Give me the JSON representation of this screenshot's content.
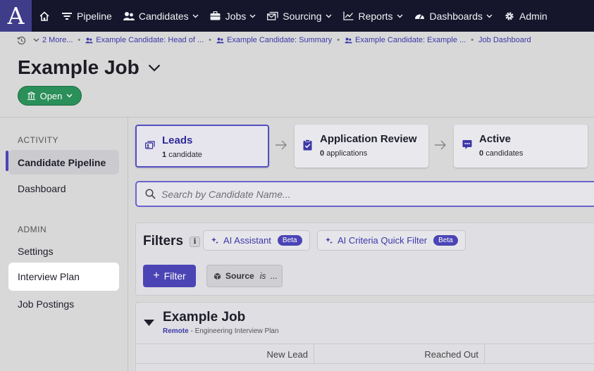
{
  "app": {
    "logo_letter": "A",
    "brand_colors": {
      "nav_bg": "#15152b",
      "accent": "#4b44b5",
      "logo_bg": "#3f3d8a",
      "status_green": "#2a8f59"
    }
  },
  "nav": {
    "items": [
      {
        "label": "Pipeline",
        "icon": "funnel-icon"
      },
      {
        "label": "Candidates",
        "icon": "people-icon"
      },
      {
        "label": "Jobs",
        "icon": "briefcase-icon"
      },
      {
        "label": "Sourcing",
        "icon": "mail-stack-icon"
      },
      {
        "label": "Reports",
        "icon": "chart-icon"
      },
      {
        "label": "Dashboards",
        "icon": "gauge-icon"
      },
      {
        "label": "Admin",
        "icon": "gear-icon"
      }
    ]
  },
  "breadcrumbs": {
    "more_label": "2 More...",
    "items": [
      "Example Candidate: Head of ...",
      "Example Candidate: Summary",
      "Example Candidate: Example ...",
      "Job Dashboard"
    ]
  },
  "header": {
    "title": "Example Job",
    "status": "Open"
  },
  "sidebar": {
    "activity_label": "ACTIVITY",
    "admin_label": "ADMIN",
    "items": [
      {
        "label": "Candidate Pipeline"
      },
      {
        "label": "Dashboard"
      },
      {
        "label": "Settings"
      },
      {
        "label": "Interview Plan"
      },
      {
        "label": "Job Postings"
      }
    ]
  },
  "stages": [
    {
      "title": "Leads",
      "count": "1",
      "unit": "candidate"
    },
    {
      "title": "Application Review",
      "count": "0",
      "unit": "applications"
    },
    {
      "title": "Active",
      "count": "0",
      "unit": "candidates"
    }
  ],
  "search": {
    "placeholder": "Search by Candidate Name..."
  },
  "filters": {
    "title": "Filters",
    "info": "i",
    "ai_assistant": "AI Assistant",
    "ai_criteria": "AI Criteria Quick Filter",
    "beta": "Beta",
    "add_filter": "Filter",
    "source_label": "Source",
    "source_op": "is",
    "source_value": "..."
  },
  "job_section": {
    "title": "Example Job",
    "location": "Remote",
    "plan": " - Engineering Interview Plan",
    "columns": [
      "New Lead",
      "Reached Out"
    ]
  }
}
